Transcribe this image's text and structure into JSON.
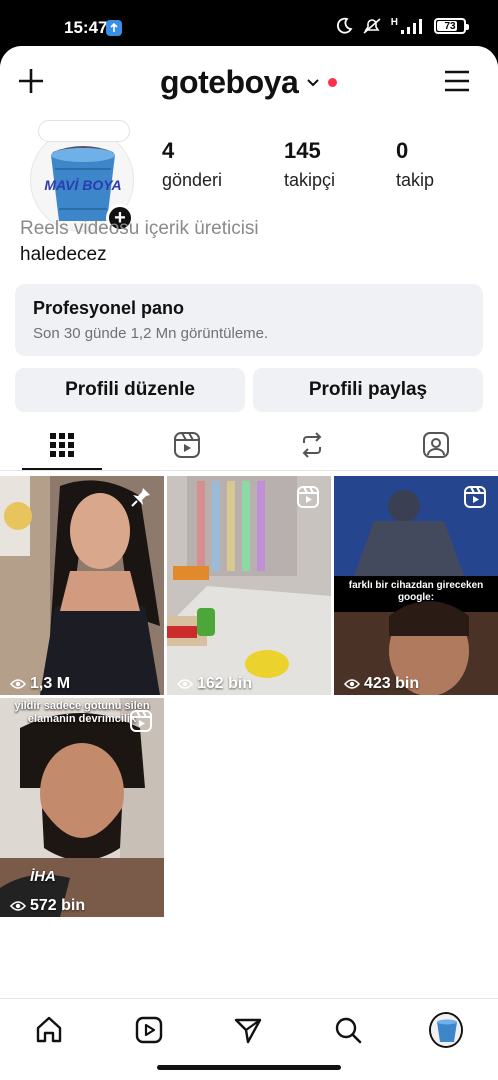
{
  "status_bar": {
    "time": "15:47",
    "network": "H",
    "battery": "73"
  },
  "header": {
    "username": "goteboya",
    "chevron": "chevron-down-icon",
    "notification_dot_color": "#ff2f4b"
  },
  "profile": {
    "avatar_text": "MAVİ BOYA",
    "stats": [
      {
        "value": "4",
        "label": "gönderi"
      },
      {
        "value": "145",
        "label": "takipçi"
      },
      {
        "value": "0",
        "label": "takip"
      }
    ],
    "category": "Reels videosu içerik üreticisi",
    "bio": "haledecez"
  },
  "professional_dashboard": {
    "title": "Profesyonel pano",
    "subtitle": "Son 30 günde 1,2 Mn görüntüleme."
  },
  "buttons": {
    "edit_profile": "Profili düzenle",
    "share_profile": "Profili paylaş"
  },
  "tabs": [
    "grid-icon",
    "reels-icon",
    "reposts-icon",
    "tagged-icon"
  ],
  "posts": [
    {
      "views": "1,3 M",
      "type": "pinned"
    },
    {
      "views": "162 bin",
      "type": "reel"
    },
    {
      "views": "423 bin",
      "type": "reel",
      "caption": "farklı bir cihazdan gireceken google:"
    },
    {
      "views": "572 bin",
      "type": "reel",
      "caption": "yildir sadece gotunu silen elamanin devrimcilik",
      "watermark": "İHA"
    }
  ],
  "bottom_nav": [
    "home-icon",
    "reels-icon",
    "messages-icon",
    "search-icon",
    "profile-avatar"
  ]
}
